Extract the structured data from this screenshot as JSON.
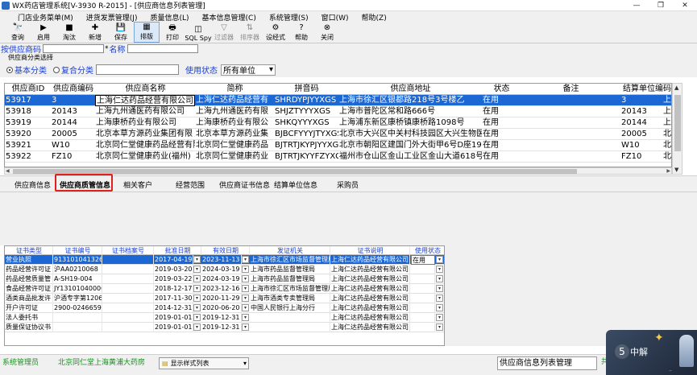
{
  "window": {
    "title": "WX药店管理系统[V-3930 R-2015] - [供应商信息列表管理]",
    "buttons": [
      "—",
      "❐",
      "✕"
    ]
  },
  "menu": [
    "门店业务菜单(M)",
    "进货发票管理(J)",
    "质量信息(L)",
    "基本信息管理(C)",
    "系统管理(S)",
    "窗口(W)",
    "帮助(Z)"
  ],
  "toolbar": [
    {
      "label": "查询",
      "icon": "binoculars-icon",
      "glyph": "🔭"
    },
    {
      "label": "启用",
      "icon": "play-icon",
      "glyph": "▶"
    },
    {
      "label": "淘汰",
      "icon": "stop-icon",
      "glyph": "■"
    },
    {
      "label": "新增",
      "icon": "new-icon",
      "glyph": "✚"
    },
    {
      "label": "保存",
      "icon": "save-icon",
      "glyph": "💾"
    },
    {
      "label": "排版",
      "icon": "layout-icon",
      "glyph": "▦"
    },
    {
      "label": "打印",
      "icon": "print-icon",
      "glyph": "🖶"
    },
    {
      "label": "SQL Spy",
      "icon": "sql-icon",
      "glyph": "◫"
    },
    {
      "label": "过滤器",
      "icon": "filter-icon",
      "glyph": "▽"
    },
    {
      "label": "排序器",
      "icon": "sort-icon",
      "glyph": "⇅"
    },
    {
      "label": "设经式",
      "icon": "settings-icon",
      "glyph": "⚙"
    },
    {
      "label": "帮助",
      "icon": "help-icon",
      "glyph": "?"
    },
    {
      "label": "关闭",
      "icon": "close-icon",
      "glyph": "⊗"
    }
  ],
  "search": {
    "code_label": "按供应商码",
    "name_label": "名称"
  },
  "filter": {
    "group_label": "供应商分类选择",
    "radio1": "基本分类",
    "radio2": "复合分类",
    "status_label": "使用状态",
    "status_value": "所有单位"
  },
  "grid": {
    "columns": [
      "供应商ID",
      "供应商编码",
      "供应商名称",
      "简称",
      "拼音码",
      "供应商地址",
      "状态",
      "备注",
      "结算单位编码"
    ],
    "rows": [
      [
        "53917",
        "3",
        "上海仁达药品经营有限公司",
        "上海仁达药品经营有",
        "SHRDYPJYYXGS",
        "上海市徐汇区银都路218号3号楼乙",
        "在用",
        "",
        "3",
        "上"
      ],
      [
        "53918",
        "20143",
        "上海九州通医药有限公司",
        "上海九州通医药有限",
        "SHJZTYYYXGS",
        "上海市普陀区常和路666号",
        "在用",
        "",
        "20143",
        "上"
      ],
      [
        "53919",
        "20144",
        "上海康桥药业有限公司",
        "上海康桥药业有限公",
        "SHKQYYYXGS",
        "上海浦东新区康桥镇康桥路1098号",
        "在用",
        "",
        "20144",
        "上"
      ],
      [
        "53920",
        "20005",
        "北京本草方源药业集团有限",
        "北京本草方源药业集",
        "BJBCFYYYJTYXGS",
        "北京市大兴区中关村科技园区大兴生物医药",
        "在用",
        "",
        "20005",
        "北"
      ],
      [
        "53921",
        "W10",
        "北京同仁堂健康药品经营有限",
        "北京同仁堂健康药品",
        "BJTRTJKYPJYYXGS",
        "北京市朝阳区建国门外大街甲6号D座19层",
        "在用",
        "",
        "W10",
        "北"
      ],
      [
        "53922",
        "FZ10",
        "北京同仁堂健康药业(福州)",
        "北京同仁堂健康药业",
        "BJTRTJKYYFZYXGS",
        "福州市仓山区金山工业区金山大道618号",
        "在用",
        "",
        "FZ10",
        "北"
      ]
    ]
  },
  "tabs": [
    "供应商信息",
    "供应商质管信息",
    "相关客户",
    "经营范围",
    "供应商证书信息",
    "结算单位信息",
    "采购员"
  ],
  "subgrid": {
    "columns": [
      "证书类型",
      "证书编号",
      "证书档案号",
      "批准日期",
      "有效日期",
      "发证机关",
      "证书说明",
      "使用状态"
    ],
    "rows": [
      [
        "营业执照",
        "91310104132601224",
        "",
        "2017-04-19",
        "2023-11-13",
        "上海市徐汇区市场监督管理局",
        "上海仁达药品经营有限公司",
        "在用"
      ],
      [
        "药品经营许可证",
        "沪AA0210068",
        "",
        "2019-03-20",
        "2024-03-19",
        "上海市药品监督管理局",
        "上海仁达药品经营有限公司",
        ""
      ],
      [
        "药品经营质量管",
        "A-SH19-004",
        "",
        "2019-03-22",
        "2024-03-19",
        "上海市药品监督管理局",
        "上海仁达药品经营有限公司",
        ""
      ],
      [
        "食品经营许可证",
        "JY13101040000055",
        "",
        "2018-12-17",
        "2023-12-16",
        "上海市徐汇区市场监督管理局",
        "上海仁达药品经营有限公司",
        ""
      ],
      [
        "酒类商品批发许",
        "沪酒专字第12060",
        "",
        "2017-11-30",
        "2020-11-29",
        "上海市酒类专卖管理局",
        "上海仁达药品经营有限公司",
        ""
      ],
      [
        "开户许可证",
        "2900-02466596",
        "",
        "2014-12-31",
        "2020-06-20",
        "中国人民银行上海分行",
        "上海仁达药品经营有限公司",
        ""
      ],
      [
        "法人委托书",
        "",
        "",
        "2019-01-01",
        "2019-12-31",
        "",
        "上海仁达药品经营有限公司",
        ""
      ],
      [
        "质量保证协议书",
        "",
        "",
        "2019-01-01",
        "2019-12-31",
        "",
        "上海仁达药品经营有限公司",
        ""
      ]
    ]
  },
  "status": {
    "user": "系统管理员",
    "store": "北京同仁堂上海黄浦大药房",
    "display_style": "显示样式列表",
    "window_name": "供应商信息列表管理",
    "right_text": "共"
  },
  "overlay": {
    "number": "5",
    "text": "中解",
    "small": "·· "
  }
}
